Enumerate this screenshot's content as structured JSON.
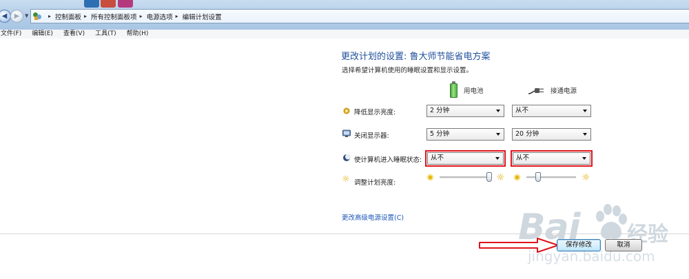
{
  "window": {
    "breadcrumb": [
      "控制面板",
      "所有控制面板项",
      "电源选项",
      "编辑计划设置"
    ]
  },
  "menubar": [
    {
      "label": "文件(F)"
    },
    {
      "label": "编辑(E)"
    },
    {
      "label": "查看(V)"
    },
    {
      "label": "工具(T)"
    },
    {
      "label": "帮助(H)"
    }
  ],
  "main": {
    "title": "更改计划的设置: 鲁大师节能省电方案",
    "subtitle": "选择希望计算机使用的睡眠设置和显示设置。",
    "columns": {
      "battery": {
        "label": "用电池",
        "icon": "battery-icon"
      },
      "plugged": {
        "label": "接通电源",
        "icon": "power-plug-icon"
      }
    },
    "settings": [
      {
        "label": "降低显示亮度:",
        "icon": "dim-display-icon",
        "battery": "2 分钟",
        "plugged": "从不"
      },
      {
        "label": "关闭显示器:",
        "icon": "monitor-icon",
        "battery": "5 分钟",
        "plugged": "20 分钟"
      },
      {
        "label": "使计算机进入睡眠状态:",
        "icon": "sleep-moon-icon",
        "battery": "从不",
        "plugged": "从不"
      }
    ],
    "brightness": {
      "label": "调整计划亮度:",
      "icon": "brightness-sun-icon",
      "battery_level": 1.0,
      "plugged_level": 0.2
    },
    "advanced_link": "更改高级电源设置(C)",
    "save_button": "保存修改",
    "cancel_button": "取消"
  },
  "annotations": {
    "highlight_color": "#e0141b",
    "arrow_color": "#e0141b",
    "highlighted_controls": [
      "sleep-battery",
      "sleep-plugged"
    ],
    "arrow_target": "save-button"
  },
  "watermark": {
    "brand": "Bai",
    "brand2": "经验",
    "url": "jingyan.baidu.com"
  },
  "colors": {
    "title": "#1f4f9b",
    "link": "#1b56b8",
    "address_bar_bg": "#b6cfe9"
  }
}
